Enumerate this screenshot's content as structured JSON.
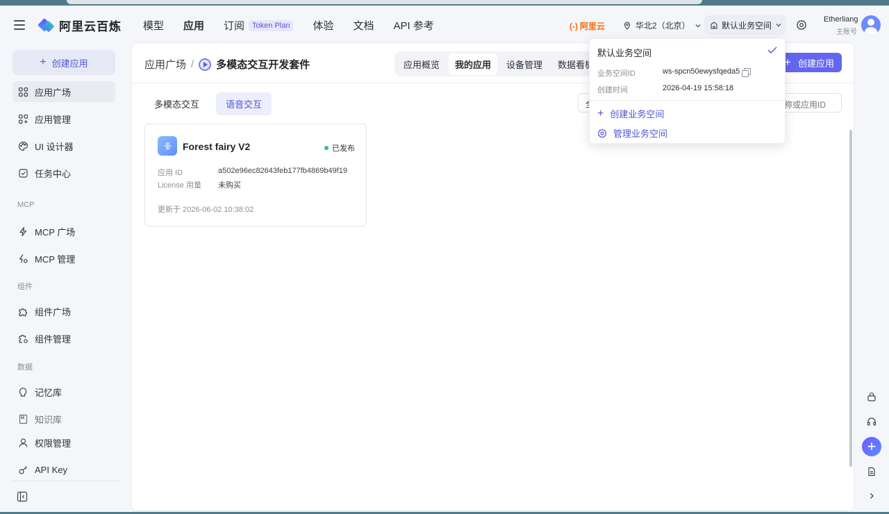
{
  "header": {
    "logo_text": "阿里云百炼",
    "nav": [
      {
        "label": "模型"
      },
      {
        "label": "应用"
      },
      {
        "label": "订阅"
      },
      {
        "label": "体验"
      },
      {
        "label": "文档"
      },
      {
        "label": "API 参考"
      }
    ],
    "token_plan": "Token Plan",
    "aliyun_brand": "阿里云",
    "aliyun_bracket": "(-)",
    "region": "华北2（北京）",
    "workspace": "默认业务空间",
    "user_name": "Etherliang",
    "user_role": "主账号"
  },
  "sidebar": {
    "create_app": "创建应用",
    "items": [
      {
        "label": "应用广场",
        "icon": "grid-icon"
      },
      {
        "label": "应用管理",
        "icon": "grid-manage-icon"
      },
      {
        "label": "UI 设计器",
        "icon": "palette-icon"
      },
      {
        "label": "任务中心",
        "icon": "task-icon"
      },
      {
        "label": "MCP 广场",
        "icon": "lightning-icon"
      },
      {
        "label": "MCP 管理",
        "icon": "lightning-manage-icon"
      },
      {
        "label": "组件广场",
        "icon": "puzzle-icon"
      },
      {
        "label": "组件管理",
        "icon": "puzzle-manage-icon"
      },
      {
        "label": "记忆库",
        "icon": "memory-icon"
      },
      {
        "label": "知识库",
        "icon": "book-icon"
      },
      {
        "label": "权限管理",
        "icon": "user-icon"
      },
      {
        "label": "API Key",
        "icon": "key-icon"
      }
    ],
    "sections": [
      "MCP",
      "组件",
      "数据"
    ]
  },
  "main": {
    "breadcrumb_root": "应用广场",
    "breadcrumb_sep": "/",
    "breadcrumb_current": "多模态交互开发套件",
    "tabs": [
      {
        "label": "应用概览"
      },
      {
        "label": "我的应用"
      },
      {
        "label": "设备管理"
      },
      {
        "label": "数据看板"
      }
    ],
    "create_button": "创建应用",
    "subtabs": [
      {
        "label": "多模态交互"
      },
      {
        "label": "语音交互"
      }
    ],
    "filter_value": "全部",
    "search_placeholder": "请输入应用名称或应用ID",
    "card": {
      "icon_text": "-|||-",
      "title": "Forest fairy V2",
      "status": "已发布",
      "app_id_label": "应用 ID",
      "app_id": "a502e96ec82643feb177fb4869b49f19",
      "license_label": "License 用量",
      "license_value": "未购买",
      "updated": "更新于 2026-06-02 10:38:02"
    }
  },
  "dropdown": {
    "title": "默认业务空间",
    "ws_id_label": "业务空间ID",
    "ws_id": "ws-spcn50ewysfqeda5",
    "created_label": "创建时间",
    "created": "2026-04-19 15:58:18",
    "create_ws": "创建业务空间",
    "manage_ws": "管理业务空间"
  },
  "colors": {
    "accent": "#6366f1",
    "brand_orange": "#ff6a00",
    "status_green": "#2fbf8f"
  }
}
